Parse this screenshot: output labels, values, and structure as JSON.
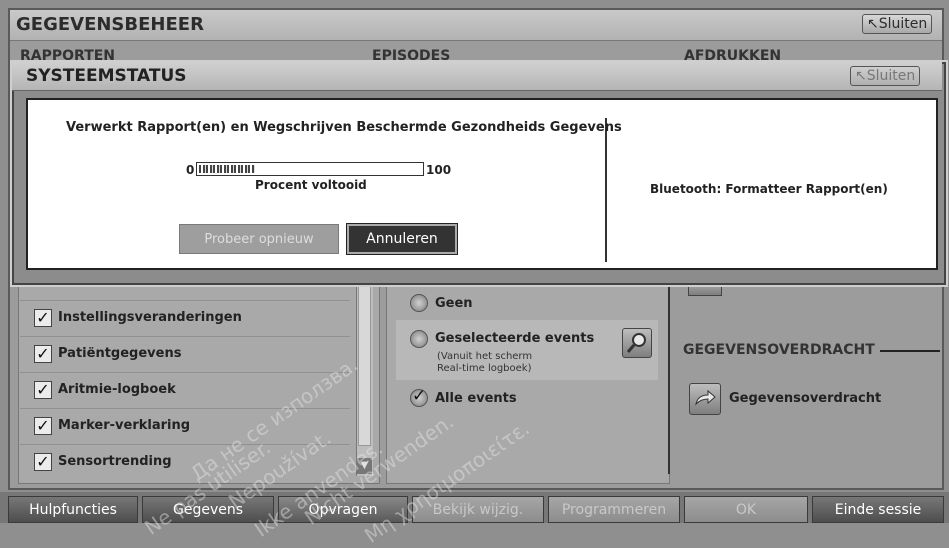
{
  "window": {
    "title": "GEGEVENSBEHEER",
    "close_label": "Sluiten"
  },
  "sections": {
    "reports": "RAPPORTEN",
    "episodes": "EPISODES",
    "printouts": "AFDRUKKEN"
  },
  "dialog": {
    "title": "SYSTEEMSTATUS",
    "close_label": "Sluiten",
    "message": "Verwerkt Rapport(en) en Wegschrijven Beschermde Gezondheids Gegevens",
    "progress_min": "0",
    "progress_max": "100",
    "progress_value": 25,
    "progress_label": "Procent voltooid",
    "bluetooth_status": "Bluetooth: Formatteer Rapport(en)",
    "retry_label": "Probeer opnieuw",
    "cancel_label": "Annuleren"
  },
  "report_items": [
    {
      "label": "Instellingsveranderingen",
      "checked": "✓"
    },
    {
      "label": "Patiëntgegevens",
      "checked": "✓"
    },
    {
      "label": "Aritmie-logboek",
      "checked": "✓"
    },
    {
      "label": "Marker-verklaring",
      "checked": "✓"
    },
    {
      "label": "Sensortrending",
      "checked": "✓"
    }
  ],
  "episodes": {
    "none_label": "Geen",
    "selected_label": "Geselecteerde events",
    "selected_note_1": "(Vanuit het scherm",
    "selected_note_2": "Real-time logboek)",
    "all_label": "Alle events",
    "all_check": "✓"
  },
  "transfer": {
    "heading": "GEGEVENSOVERDRACHT",
    "button_label": "Gegevensoverdracht"
  },
  "bottom_bar": {
    "help": "Hulpfuncties",
    "data": "Gegevens",
    "interrogate": "Opvragen",
    "view_changes": "Bekijk wijzig.",
    "program": "Programmeren",
    "ok": "OK",
    "end_session": "Einde sessie"
  },
  "watermarks": [
    "Да не се използва.",
    "Nepoužívat.",
    "Ikke anvendes.",
    "Nicht verwenden.",
    "Μη χρησιμοποιείτε.",
    "Ne pas utiliser."
  ],
  "colors": {
    "accent_dark": "#333333",
    "panel": "#a9a9a9",
    "background": "#8f8f8f"
  }
}
